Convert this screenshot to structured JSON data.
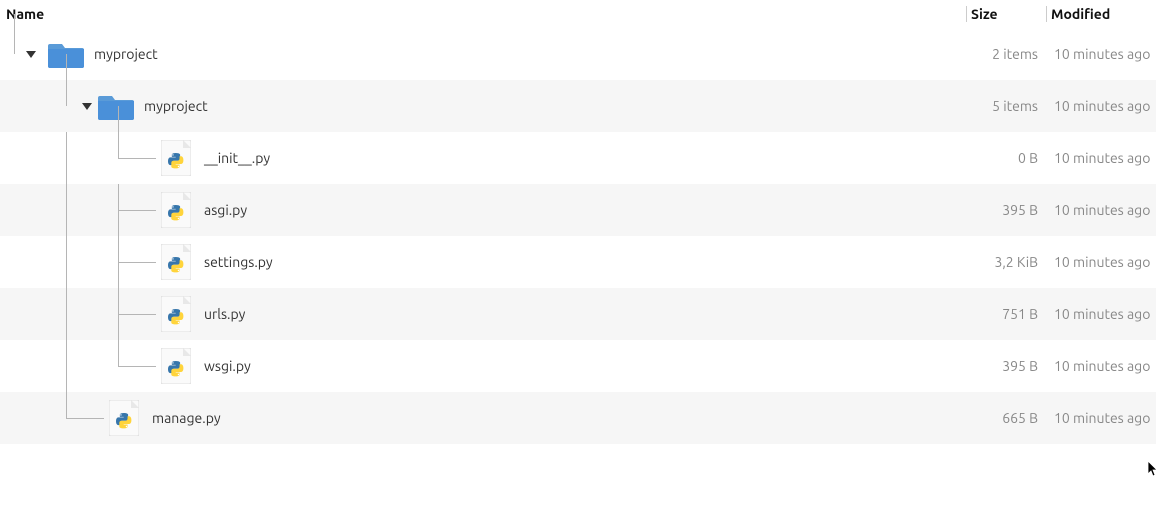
{
  "columns": {
    "name": "Name",
    "size": "Size",
    "modified": "Modified"
  },
  "rows": [
    {
      "id": "root",
      "depth": 0,
      "type": "folder",
      "expanded": true,
      "name": "myproject",
      "size": "2 items",
      "modified": "10 minutes ago"
    },
    {
      "id": "inner",
      "depth": 1,
      "type": "folder",
      "expanded": true,
      "name": "myproject",
      "size": "5 items",
      "modified": "10 minutes ago"
    },
    {
      "id": "init",
      "depth": 2,
      "type": "py",
      "expanded": null,
      "name": "__init__.py",
      "size": "0 B",
      "modified": "10 minutes ago"
    },
    {
      "id": "asgi",
      "depth": 2,
      "type": "py",
      "expanded": null,
      "name": "asgi.py",
      "size": "395 B",
      "modified": "10 minutes ago"
    },
    {
      "id": "settings",
      "depth": 2,
      "type": "py",
      "expanded": null,
      "name": "settings.py",
      "size": "3,2 KiB",
      "modified": "10 minutes ago"
    },
    {
      "id": "urls",
      "depth": 2,
      "type": "py",
      "expanded": null,
      "name": "urls.py",
      "size": "751 B",
      "modified": "10 minutes ago"
    },
    {
      "id": "wsgi",
      "depth": 2,
      "type": "py",
      "expanded": null,
      "name": "wsgi.py",
      "size": "395 B",
      "modified": "10 minutes ago"
    },
    {
      "id": "manage",
      "depth": 1,
      "type": "py",
      "expanded": null,
      "name": "manage.py",
      "size": "665 B",
      "modified": "10 minutes ago"
    }
  ]
}
